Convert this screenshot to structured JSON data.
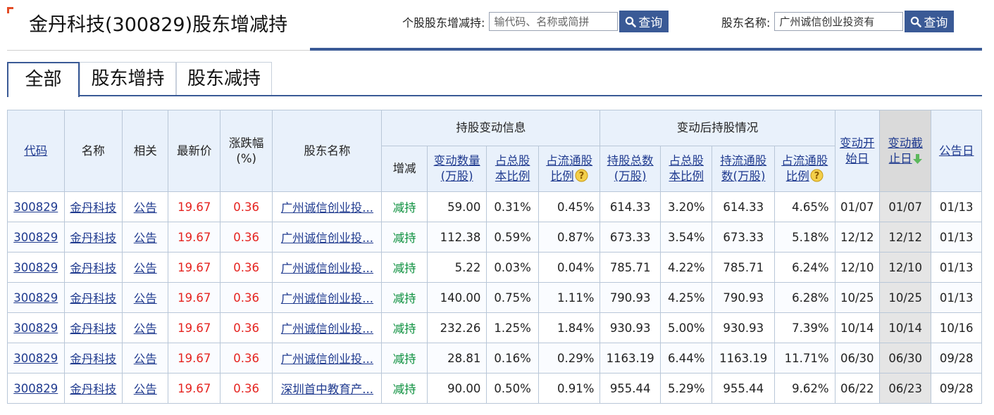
{
  "page": {
    "title": "金丹科技(300829)股东增减持"
  },
  "search_stock": {
    "label": "个股股东增减持:",
    "placeholder": "输代码、名称或简拼",
    "button": "查询"
  },
  "search_holder": {
    "label": "股东名称:",
    "value": "广州诚信创业投资有",
    "button": "查询"
  },
  "tabs": [
    {
      "label": "全部",
      "active": true
    },
    {
      "label": "股东增持",
      "active": false
    },
    {
      "label": "股东减持",
      "active": false
    }
  ],
  "headers": {
    "code": "代码",
    "name": "名称",
    "related": "相关",
    "price": "最新价",
    "change_pct_line1": "涨跌幅",
    "change_pct_line2": "(%)",
    "holder": "股东名称",
    "group_change": "持股变动信息",
    "group_after": "变动后持股情况",
    "direction": "增减",
    "qty_line1": "变动数量",
    "qty_line2": "(万股)",
    "pct_total_line1": "占总股",
    "pct_total_line2": "本比例",
    "pct_float_line1": "占流通股",
    "pct_float_line2": "比例",
    "after_total_line1": "持股总数",
    "after_total_line2": "(万股)",
    "after_pct_total_line1": "占总股",
    "after_pct_total_line2": "本比例",
    "after_float_line1": "持流通股",
    "after_float_line2": "数(万股)",
    "after_pct_float_line1": "占流通股",
    "after_pct_float_line2": "比例",
    "start_line1": "变动开",
    "start_line2": "始日",
    "end_line1": "变动截",
    "end_line2": "止日",
    "announce": "公告日"
  },
  "rows": [
    {
      "code": "300829",
      "name": "金丹科技",
      "related": "公告",
      "price": "19.67",
      "change": "0.36",
      "holder": "广州诚信创业投...",
      "direction": "减持",
      "qty": "59.00",
      "pct_total": "0.31%",
      "pct_float": "0.45%",
      "after_total": "614.33",
      "after_pct_total": "3.20%",
      "after_float": "614.33",
      "after_pct_float": "4.65%",
      "start": "01/07",
      "end": "01/07",
      "announce": "01/13"
    },
    {
      "code": "300829",
      "name": "金丹科技",
      "related": "公告",
      "price": "19.67",
      "change": "0.36",
      "holder": "广州诚信创业投...",
      "direction": "减持",
      "qty": "112.38",
      "pct_total": "0.59%",
      "pct_float": "0.87%",
      "after_total": "673.33",
      "after_pct_total": "3.54%",
      "after_float": "673.33",
      "after_pct_float": "5.18%",
      "start": "12/12",
      "end": "12/12",
      "announce": "01/13"
    },
    {
      "code": "300829",
      "name": "金丹科技",
      "related": "公告",
      "price": "19.67",
      "change": "0.36",
      "holder": "广州诚信创业投...",
      "direction": "减持",
      "qty": "5.22",
      "pct_total": "0.03%",
      "pct_float": "0.04%",
      "after_total": "785.71",
      "after_pct_total": "4.22%",
      "after_float": "785.71",
      "after_pct_float": "6.24%",
      "start": "12/10",
      "end": "12/10",
      "announce": "01/13"
    },
    {
      "code": "300829",
      "name": "金丹科技",
      "related": "公告",
      "price": "19.67",
      "change": "0.36",
      "holder": "广州诚信创业投...",
      "direction": "减持",
      "qty": "140.00",
      "pct_total": "0.75%",
      "pct_float": "1.11%",
      "after_total": "790.93",
      "after_pct_total": "4.25%",
      "after_float": "790.93",
      "after_pct_float": "6.28%",
      "start": "10/25",
      "end": "10/25",
      "announce": "01/13"
    },
    {
      "code": "300829",
      "name": "金丹科技",
      "related": "公告",
      "price": "19.67",
      "change": "0.36",
      "holder": "广州诚信创业投...",
      "direction": "减持",
      "qty": "232.26",
      "pct_total": "1.25%",
      "pct_float": "1.84%",
      "after_total": "930.93",
      "after_pct_total": "5.00%",
      "after_float": "930.93",
      "after_pct_float": "7.39%",
      "start": "10/14",
      "end": "10/14",
      "announce": "10/16"
    },
    {
      "code": "300829",
      "name": "金丹科技",
      "related": "公告",
      "price": "19.67",
      "change": "0.36",
      "holder": "广州诚信创业投...",
      "direction": "减持",
      "qty": "28.81",
      "pct_total": "0.16%",
      "pct_float": "0.29%",
      "after_total": "1163.19",
      "after_pct_total": "6.44%",
      "after_float": "1163.19",
      "after_pct_float": "11.71%",
      "start": "06/30",
      "end": "06/30",
      "announce": "09/28"
    },
    {
      "code": "300829",
      "name": "金丹科技",
      "related": "公告",
      "price": "19.67",
      "change": "0.36",
      "holder": "深圳首中教育产...",
      "direction": "减持",
      "qty": "90.00",
      "pct_total": "0.50%",
      "pct_float": "0.91%",
      "after_total": "955.44",
      "after_pct_total": "5.29%",
      "after_float": "955.44",
      "after_pct_float": "9.62%",
      "start": "06/22",
      "end": "06/23",
      "announce": "09/28"
    }
  ],
  "icons": {
    "search": "search-icon",
    "help": "question-icon",
    "sort": "arrow-down-icon"
  },
  "colors": {
    "accent": "#3a5a96",
    "up": "#e52420",
    "decrease": "#0a8f3c",
    "link": "#1f3a8f",
    "header_bg": "#e9f1fb",
    "help_icon": "#e6b422",
    "sort_arrow": "#5cb85c"
  }
}
